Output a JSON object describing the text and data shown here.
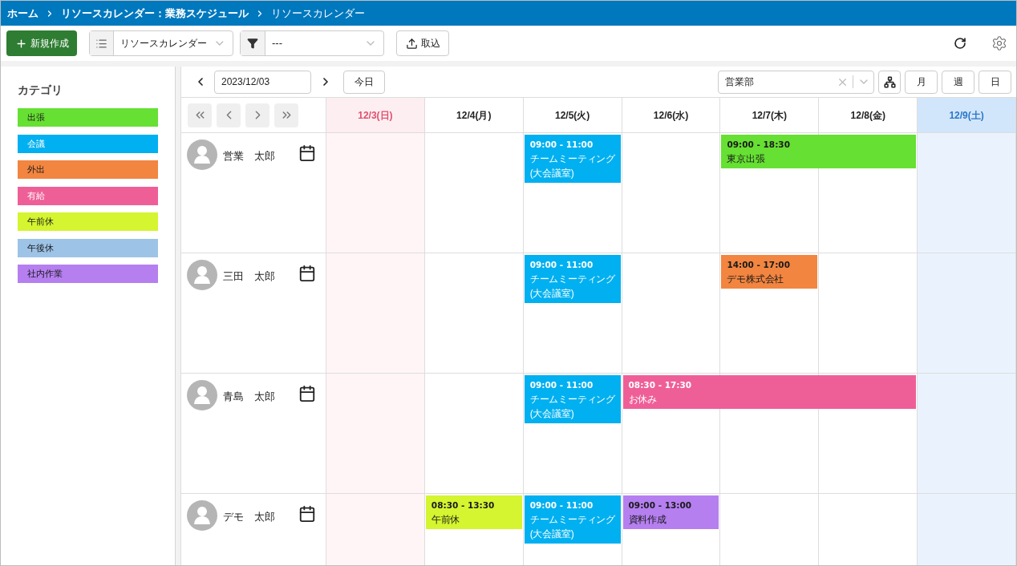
{
  "breadcrumb": [
    {
      "label": "ホーム",
      "current": false
    },
    {
      "label": "リソースカレンダー：業務スケジュール",
      "current": false
    },
    {
      "label": "リソースカレンダー",
      "current": true
    }
  ],
  "toolbar": {
    "new_button": "新規作成",
    "view_select": {
      "value": "リソースカレンダー"
    },
    "filter_select": {
      "value": "---"
    },
    "import_button": "取込"
  },
  "sidebar": {
    "title": "カテゴリ",
    "categories": [
      {
        "label": "出張",
        "color": "#66e033"
      },
      {
        "label": "会議",
        "color": "#00b0f0"
      },
      {
        "label": "外出",
        "color": "#f28540"
      },
      {
        "label": "有給",
        "color": "#ef5f97"
      },
      {
        "label": "午前休",
        "color": "#d4f530"
      },
      {
        "label": "午後休",
        "color": "#9dc3e6"
      },
      {
        "label": "社内作業",
        "color": "#b57ff0"
      }
    ]
  },
  "calendar": {
    "date_field": {
      "value": "2023/12/03"
    },
    "today_button": "今日",
    "department_select": {
      "value": "営業部"
    },
    "view_buttons": [
      {
        "label": "月",
        "selected": false
      },
      {
        "label": "週",
        "selected": false
      },
      {
        "label": "日",
        "selected": false
      }
    ],
    "days": [
      {
        "label": "12/3(日)",
        "kind": "sunday"
      },
      {
        "label": "12/4(月)",
        "kind": "weekday"
      },
      {
        "label": "12/5(火)",
        "kind": "weekday"
      },
      {
        "label": "12/6(水)",
        "kind": "weekday"
      },
      {
        "label": "12/7(木)",
        "kind": "weekday"
      },
      {
        "label": "12/8(金)",
        "kind": "weekday"
      },
      {
        "label": "12/9(土)",
        "kind": "saturday"
      }
    ],
    "resources": [
      {
        "name": "営業　太郎",
        "cells": [
          {
            "kind": "empty"
          },
          {
            "kind": "empty"
          },
          {
            "kind": "event",
            "time": "09:00 - 11:00",
            "title": "チームミーティング(大会議室)",
            "color": "#00b0f0"
          },
          {
            "kind": "empty"
          },
          {
            "kind": "event",
            "time": "09:00 - 18:30",
            "title": "東京出張",
            "color": "#66e033"
          },
          {
            "kind": "continuation"
          },
          {
            "kind": "empty"
          }
        ]
      },
      {
        "name": "三田　太郎",
        "cells": [
          {
            "kind": "empty"
          },
          {
            "kind": "empty"
          },
          {
            "kind": "event",
            "time": "09:00 - 11:00",
            "title": "チームミーティング(大会議室)",
            "color": "#00b0f0"
          },
          {
            "kind": "empty"
          },
          {
            "kind": "event",
            "time": "14:00 - 17:00",
            "title": "デモ株式会社",
            "color": "#f28540"
          },
          {
            "kind": "empty"
          },
          {
            "kind": "empty"
          }
        ]
      },
      {
        "name": "青島　太郎",
        "cells": [
          {
            "kind": "empty"
          },
          {
            "kind": "empty"
          },
          {
            "kind": "event",
            "time": "09:00 - 11:00",
            "title": "チームミーティング(大会議室)",
            "color": "#00b0f0"
          },
          {
            "kind": "event",
            "time": "08:30 - 17:30",
            "title": "お休み",
            "color": "#ef5f97"
          },
          {
            "kind": "continuation"
          },
          {
            "kind": "continuation"
          },
          {
            "kind": "empty"
          }
        ]
      },
      {
        "name": "デモ　太郎",
        "cells": [
          {
            "kind": "empty"
          },
          {
            "kind": "event",
            "time": "08:30 - 13:30",
            "title": "午前休",
            "color": "#d4f530"
          },
          {
            "kind": "event",
            "time": "09:00 - 11:00",
            "title": "チームミーティング(大会議室)",
            "color": "#00b0f0"
          },
          {
            "kind": "event",
            "time": "09:00 - 13:00",
            "title": "資料作成",
            "color": "#b57ff0"
          },
          {
            "kind": "empty"
          },
          {
            "kind": "empty"
          },
          {
            "kind": "empty"
          }
        ]
      }
    ]
  }
}
